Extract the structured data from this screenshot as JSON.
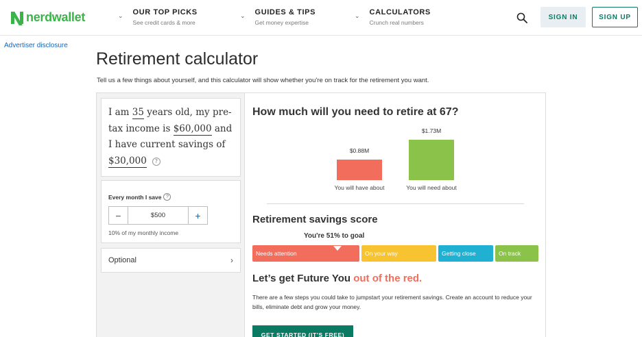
{
  "header": {
    "logo_text": "nerdwallet",
    "nav": [
      {
        "title": "OUR TOP PICKS",
        "subtitle": "See credit cards & more"
      },
      {
        "title": "GUIDES & TIPS",
        "subtitle": "Get money expertise"
      },
      {
        "title": "CALCULATORS",
        "subtitle": "Crunch real numbers"
      }
    ],
    "sign_in": "SIGN IN",
    "sign_up": "SIGN UP"
  },
  "disclosure": "Advertiser disclosure",
  "page_title": "Retirement calculator",
  "intro": "Tell us a few things about yourself, and this calculator will show whether you're on track for the retirement you want.",
  "inputs": {
    "t1": "I am ",
    "age": "35",
    "t2": " years old, my pre-tax income is ",
    "income": "$60,000",
    "t3": " and I have current savings of ",
    "savings": "$30,000",
    "help_glyph": "?",
    "monthly_label": "Every month I save",
    "minus": "−",
    "monthly_value": "$500",
    "plus": "+",
    "monthly_note": "10% of my monthly income",
    "optional_label": "Optional",
    "optional_chevron": "›"
  },
  "results": {
    "question": "How much will you need to retire at 67?",
    "have": {
      "value": "$0.88M",
      "label": "You will have about",
      "color": "#f26d5b"
    },
    "need": {
      "value": "$1.73M",
      "label": "You will need about",
      "color": "#8bc34a"
    },
    "score_title": "Retirement savings score",
    "score_goal": "You're 51% to goal",
    "score_percent": 51,
    "segments": [
      {
        "label": "Needs attention",
        "color": "#f26d5b"
      },
      {
        "label": "On your way",
        "color": "#f7c331"
      },
      {
        "label": "Getting close",
        "color": "#1fb0d2"
      },
      {
        "label": "On track",
        "color": "#8bc34a"
      }
    ],
    "future_title_a": "Let’s get Future You ",
    "future_title_b": "out of the red.",
    "future_body": "There are a few steps you could take to jumpstart your retirement savings. Create an account to reduce your bills, eliminate debt and grow your money.",
    "cta": "GET STARTED (IT'S FREE)"
  }
}
